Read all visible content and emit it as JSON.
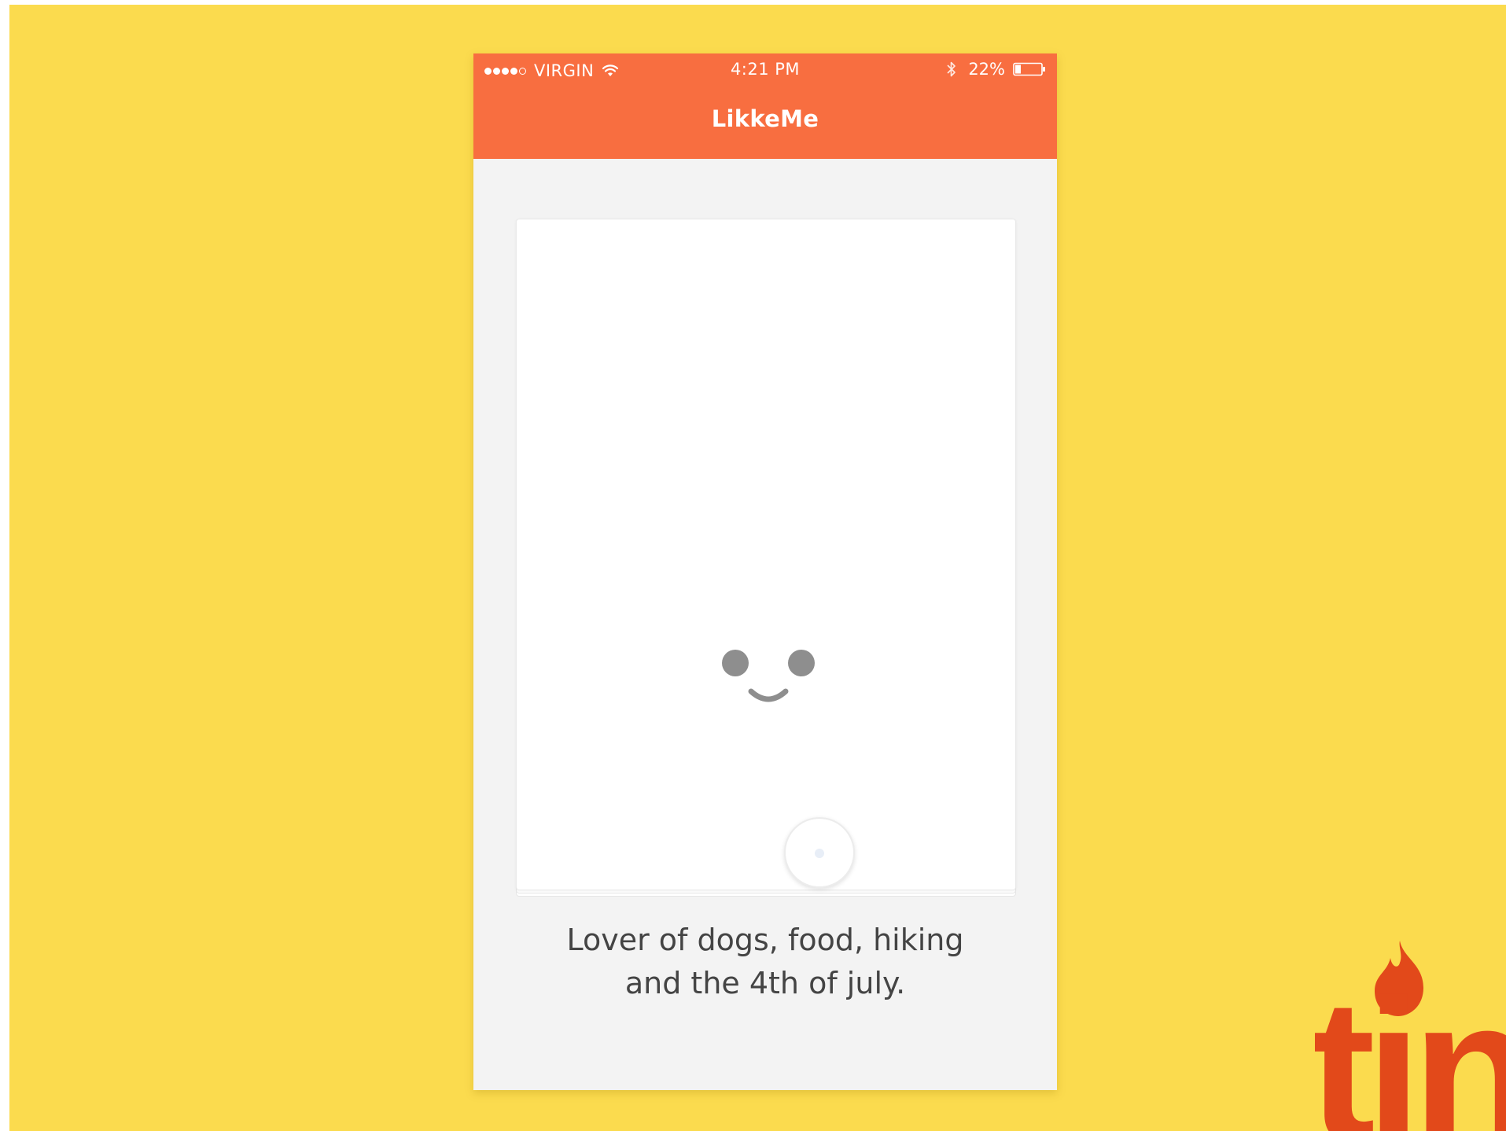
{
  "status_bar": {
    "carrier": "VIRGIN",
    "time": "4:21 PM",
    "battery": "22%",
    "signal_bars_filled": 4,
    "signal_bars_total": 5,
    "battery_level": 0.22
  },
  "header": {
    "title": "LikkeMe"
  },
  "profile_card": {
    "placeholder_icon": "smiley-face-icon"
  },
  "bio": {
    "line1": "Lover of dogs, food, hiking",
    "line2": "and the 4th of july."
  },
  "logo": {
    "text": "tin",
    "icon": "flame-icon"
  },
  "colors": {
    "background": "#FBDB4E",
    "appbar": "#F86E40",
    "logo": "#E2491A",
    "face": "#8E8E8E"
  }
}
